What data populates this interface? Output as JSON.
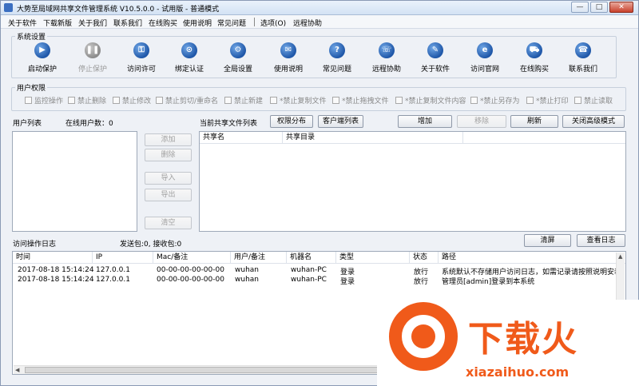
{
  "window": {
    "title": "大势至局域网共享文件管理系统 V10.5.0.0 - 试用版 - 普通模式",
    "min": "—",
    "max": "□",
    "close": "✕"
  },
  "menu": [
    "关于软件",
    "下载新版",
    "关于我们",
    "联系我们",
    "在线购买",
    "使用说明",
    "常见问题",
    "选项(O)",
    "远程协助"
  ],
  "system": {
    "label": "系统设置",
    "buttons": [
      {
        "label": "启动保护",
        "icon": "play-icon",
        "glyph": "▶",
        "enabled": true
      },
      {
        "label": "停止保护",
        "icon": "pause-icon",
        "glyph": "❚❚",
        "enabled": false
      },
      {
        "label": "访问许可",
        "icon": "key-icon",
        "glyph": "⚿",
        "enabled": true
      },
      {
        "label": "绑定认证",
        "icon": "lock-icon",
        "glyph": "⊙",
        "enabled": true
      },
      {
        "label": "全局设置",
        "icon": "gear-icon",
        "glyph": "⚙",
        "enabled": true
      },
      {
        "label": "使用说明",
        "icon": "book-icon",
        "glyph": "✉",
        "enabled": true
      },
      {
        "label": "常见问题",
        "icon": "question-icon",
        "glyph": "?",
        "enabled": true
      },
      {
        "label": "远程协助",
        "icon": "remote-icon",
        "glyph": "☏",
        "enabled": true
      },
      {
        "label": "关于软件",
        "icon": "info-icon",
        "glyph": "✎",
        "enabled": true
      },
      {
        "label": "访问官网",
        "icon": "browser-icon",
        "glyph": "e",
        "enabled": true
      },
      {
        "label": "在线购买",
        "icon": "cart-icon",
        "glyph": "⛟",
        "enabled": true
      },
      {
        "label": "联系我们",
        "icon": "phone-icon",
        "glyph": "☎",
        "enabled": true
      }
    ]
  },
  "permissions": {
    "label": "用户权限",
    "items": [
      "监控操作",
      "禁止删除",
      "禁止修改",
      "禁止剪切/重命名",
      "禁止新建",
      "*禁止复制文件",
      "*禁止拖拽文件",
      "*禁止复制文件内容",
      "*禁止另存为",
      "*禁止打印",
      "禁止读取"
    ]
  },
  "users": {
    "list_label": "用户列表",
    "online_label": "在线用户数：0",
    "buttons": [
      "添加",
      "删除",
      "导入",
      "导出",
      "清空"
    ]
  },
  "shares": {
    "label": "当前共享文件列表",
    "btn_perm": "权限分布",
    "btn_client": "客户端列表",
    "btn_add": "增加",
    "btn_remove": "移除",
    "btn_refresh": "刷新",
    "btn_advanced": "关闭高级模式",
    "columns": [
      "共享名",
      "共享目录"
    ]
  },
  "log": {
    "label": "访问操作日志",
    "stats": "发送包:0, 接收包:0",
    "btn_clear": "清屏",
    "btn_view": "查看日志",
    "columns": [
      "时间",
      "IP",
      "Mac/备注",
      "用户/备注",
      "机器名",
      "类型",
      "状态",
      "路径"
    ],
    "rows": [
      [
        "2017-08-18 15:14:24",
        "127.0.0.1",
        "00-00-00-00-00-00",
        "wuhan",
        "wuhan-PC",
        "登录",
        "放行",
        "系统默认不存储用户访问日志，如需记录请按照说明安装数据库"
      ],
      [
        "2017-08-18 15:14:24",
        "127.0.0.1",
        "00-00-00-00-00-00",
        "wuhan",
        "wuhan-PC",
        "登录",
        "放行",
        "管理员[admin]登录到本系统"
      ]
    ]
  },
  "watermark": {
    "text": "下载火",
    "url": "xiazaihuo.com"
  }
}
